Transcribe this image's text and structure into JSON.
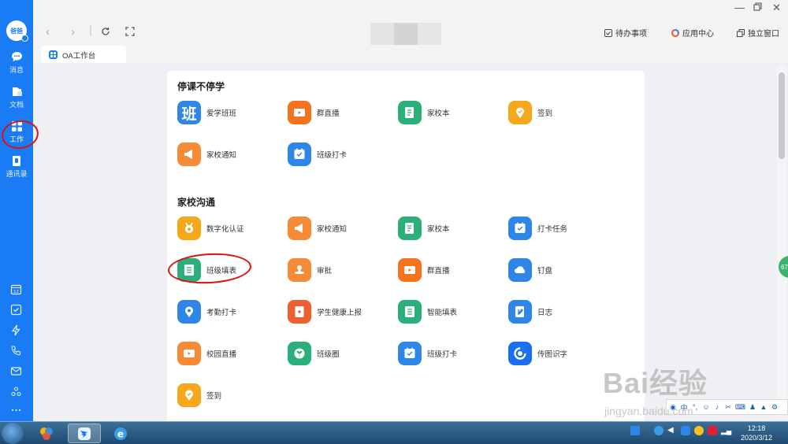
{
  "sidebar": {
    "avatar_text": "爸爸",
    "items": [
      {
        "label": "消息"
      },
      {
        "label": "文档"
      },
      {
        "label": "工作"
      },
      {
        "label": "通讯录"
      }
    ],
    "calendar_day": "12"
  },
  "topbar": {
    "todo": "待办事项",
    "app_center": "应用中心",
    "standalone": "独立窗口"
  },
  "tab": {
    "label": "OA工作台"
  },
  "sections": [
    {
      "title": "停课不停学",
      "apps": [
        {
          "label": "爱学班班",
          "icon": "ban-icon",
          "color": "#2f86e8",
          "glyph": "班"
        },
        {
          "label": "群直播",
          "icon": "live-tv-icon",
          "color": "#f5731f"
        },
        {
          "label": "家校本",
          "icon": "notebook-icon",
          "color": "#2bb07a"
        },
        {
          "label": "签到",
          "icon": "checkin-pin-icon",
          "color": "#f6a81c"
        },
        {
          "label": "家校通知",
          "icon": "megaphone-icon",
          "color": "#f58b36"
        },
        {
          "label": "班级打卡",
          "icon": "calendar-check-icon",
          "color": "#2f86e8"
        }
      ]
    },
    {
      "title": "家校沟通",
      "apps": [
        {
          "label": "数字化认证",
          "icon": "medal-icon",
          "color": "#f6a81c"
        },
        {
          "label": "家校通知",
          "icon": "megaphone-icon",
          "color": "#f58b36"
        },
        {
          "label": "家校本",
          "icon": "notebook-icon",
          "color": "#2bb07a"
        },
        {
          "label": "打卡任务",
          "icon": "calendar-check-icon",
          "color": "#2f86e8"
        },
        {
          "label": "班级填表",
          "icon": "form-icon",
          "color": "#2bb07a"
        },
        {
          "label": "审批",
          "icon": "stamp-icon",
          "color": "#f58b36"
        },
        {
          "label": "群直播",
          "icon": "live-tv-icon",
          "color": "#f5731f"
        },
        {
          "label": "钉盘",
          "icon": "cloud-icon",
          "color": "#2f86e8"
        },
        {
          "label": "考勤打卡",
          "icon": "location-pin-icon",
          "color": "#2f86e8"
        },
        {
          "label": "学生健康上报",
          "icon": "health-report-icon",
          "color": "#f0602e"
        },
        {
          "label": "智能填表",
          "icon": "form-icon",
          "color": "#2bb07a"
        },
        {
          "label": "日志",
          "icon": "log-book-icon",
          "color": "#2f86e8"
        },
        {
          "label": "校园直播",
          "icon": "live-tv-icon",
          "color": "#f58b36"
        },
        {
          "label": "班级圈",
          "icon": "leaf-circle-icon",
          "color": "#2bb07a"
        },
        {
          "label": "班级打卡",
          "icon": "calendar-check-icon",
          "color": "#2f86e8"
        },
        {
          "label": "传图识字",
          "icon": "ocr-swirl-icon",
          "color": "#1a6ff0"
        },
        {
          "label": "签到",
          "icon": "checkin-pin-icon",
          "color": "#f6a81c"
        }
      ]
    }
  ],
  "float_badge": "67",
  "ime": {
    "mode": "中"
  },
  "taskbar": {
    "time": "12:18",
    "date": "2020/3/12"
  },
  "watermark": {
    "main": "Bai经验",
    "sub": "jingyan.baidu.com"
  },
  "colors": {
    "accent": "#1a7cf5",
    "annotation": "#e01010"
  }
}
